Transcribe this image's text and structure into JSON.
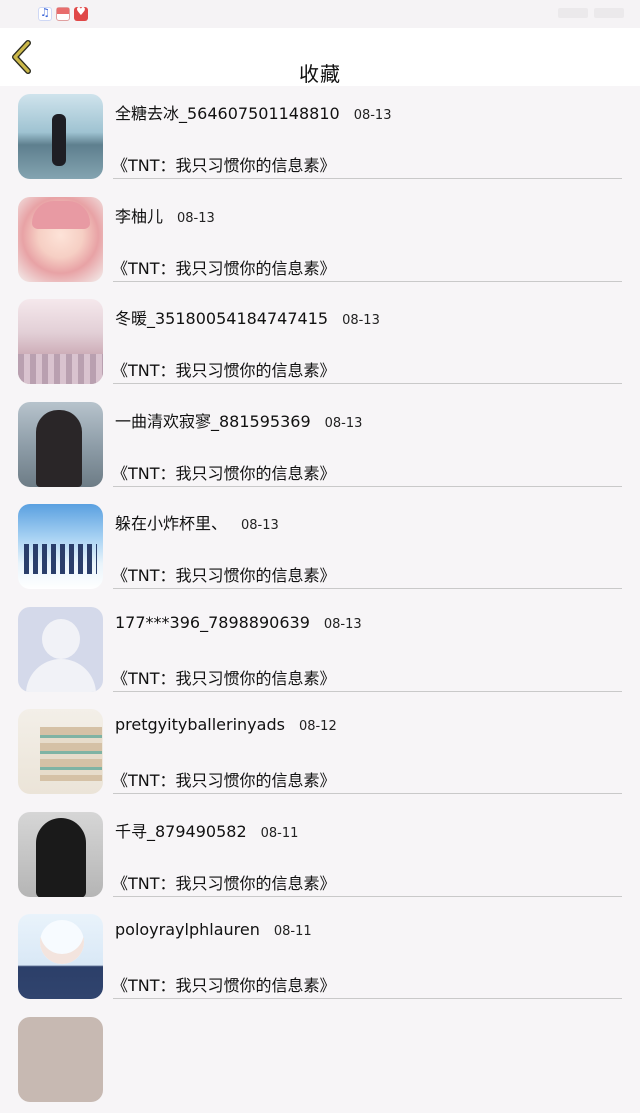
{
  "header": {
    "title": "收藏"
  },
  "list": [
    {
      "name": "全糖去冰_564607501148810",
      "date": "08-13",
      "book": "《TNT：我只习惯你的信息素》"
    },
    {
      "name": "李柚儿",
      "date": "08-13",
      "book": "《TNT：我只习惯你的信息素》"
    },
    {
      "name": "冬暖_35180054184747415",
      "date": "08-13",
      "book": "《TNT：我只习惯你的信息素》"
    },
    {
      "name": "一曲清欢寂寥_881595369",
      "date": "08-13",
      "book": "《TNT：我只习惯你的信息素》"
    },
    {
      "name": "躲在小炸杯里、",
      "date": "08-13",
      "book": "《TNT：我只习惯你的信息素》"
    },
    {
      "name": "177***396_7898890639",
      "date": "08-13",
      "book": "《TNT：我只习惯你的信息素》"
    },
    {
      "name": "pretgyityballerinyads",
      "date": "08-12",
      "book": "《TNT：我只习惯你的信息素》"
    },
    {
      "name": "千寻_879490582",
      "date": "08-11",
      "book": "《TNT：我只习惯你的信息素》"
    },
    {
      "name": "poloyraylphlauren",
      "date": "08-11",
      "book": "《TNT：我只习惯你的信息素》"
    }
  ],
  "colors": {
    "back_arrow": "#c9b84a",
    "divider": "#c9c9c9"
  },
  "icons": [
    "music-app-icon",
    "mail-app-icon",
    "heart-app-icon",
    "back-arrow-icon"
  ]
}
